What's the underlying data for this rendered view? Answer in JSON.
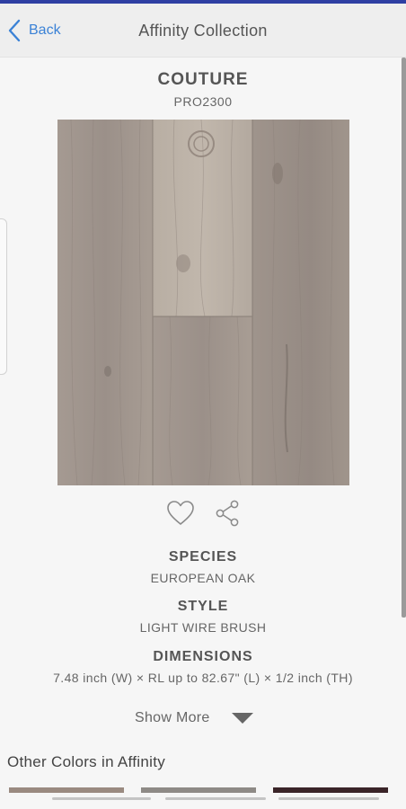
{
  "nav": {
    "back_label": "Back",
    "title": "Affinity Collection"
  },
  "product": {
    "name": "COUTURE",
    "code": "PRO2300"
  },
  "specs": [
    {
      "label": "SPECIES",
      "value": "EUROPEAN OAK"
    },
    {
      "label": "STYLE",
      "value": "LIGHT WIRE BRUSH"
    },
    {
      "label": "DIMENSIONS",
      "value": "7.48 inch (W) × RL up to 82.67\" (L) × 1/2 inch (TH)"
    }
  ],
  "show_more_label": "Show More",
  "other_colors": {
    "title": "Other Colors in Affinity",
    "thumbnails": [
      "#9a8a80",
      "#8e8a86",
      "#3a2428"
    ]
  },
  "icons": {
    "back": "chevron-left-icon",
    "favorite": "heart-icon",
    "share": "share-icon",
    "show_more": "triangle-down-icon"
  },
  "colors": {
    "link": "#3b82d6",
    "accent_bar": "#2f3fa3"
  }
}
